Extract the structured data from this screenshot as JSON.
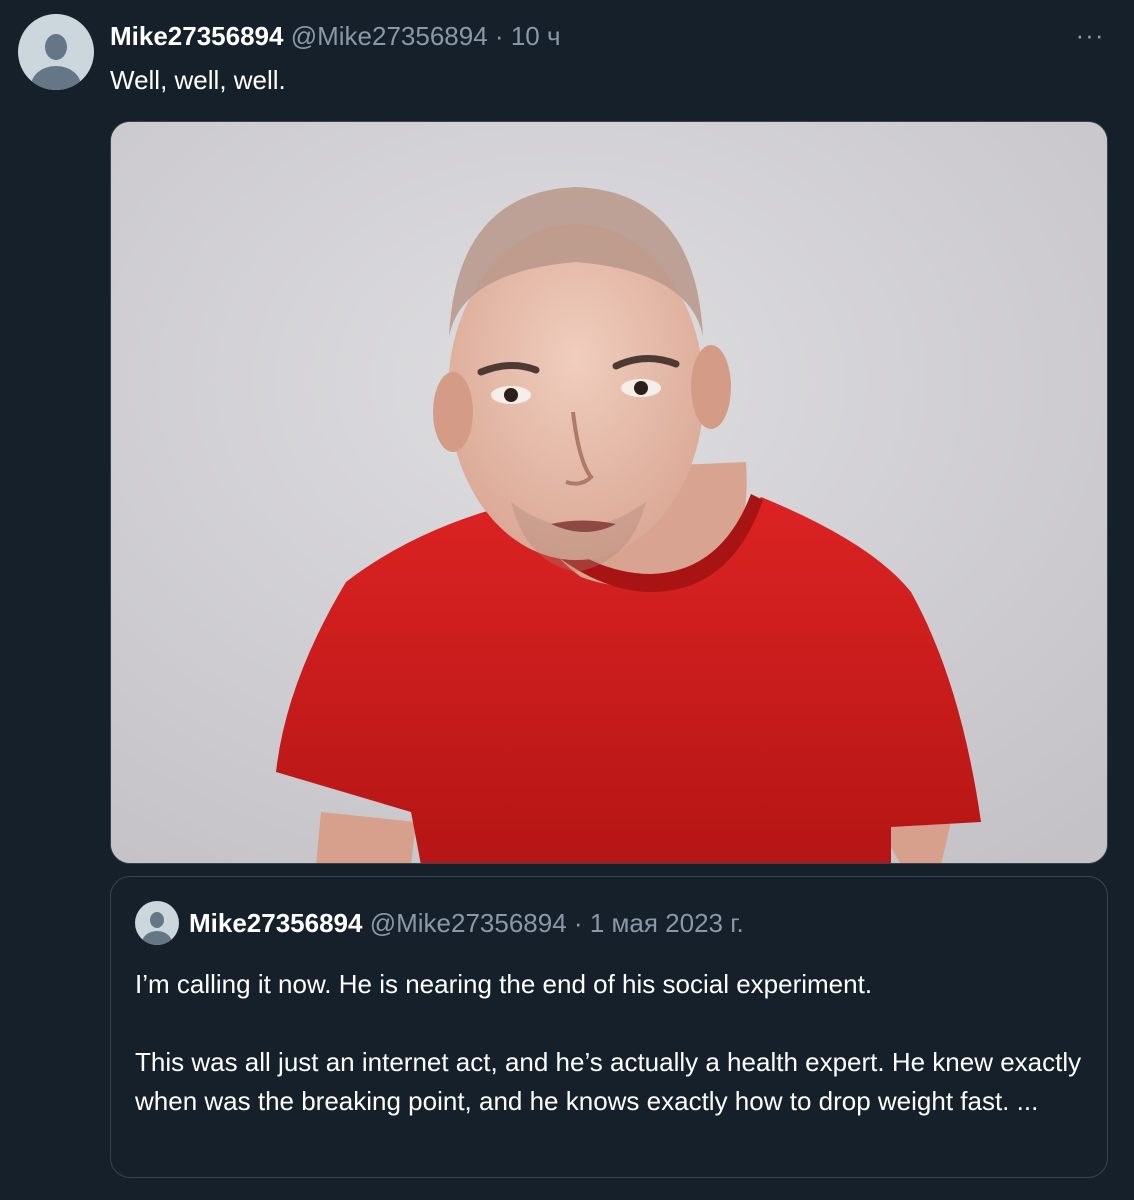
{
  "tweet": {
    "display_name": "Mike27356894",
    "handle": "@Mike27356894",
    "separator": "·",
    "time": "10 ч",
    "text": "Well, well, well.",
    "more_icon": "more-dots-icon"
  },
  "quoted_tweet": {
    "display_name": "Mike27356894",
    "handle": "@Mike27356894",
    "separator": "·",
    "date": "1 мая 2023 г.",
    "paragraph_1": "I’m calling it now. He is nearing the end of his social experiment.",
    "paragraph_2": "This was all just an internet act, and he’s actually a health expert. He knew exactly when was the breaking point, and he knows exactly how to drop weight fast. ..."
  },
  "colors": {
    "background": "#15202b",
    "secondary_text": "#8b98a5",
    "border": "#38444d",
    "shirt": "#d01c1c"
  }
}
